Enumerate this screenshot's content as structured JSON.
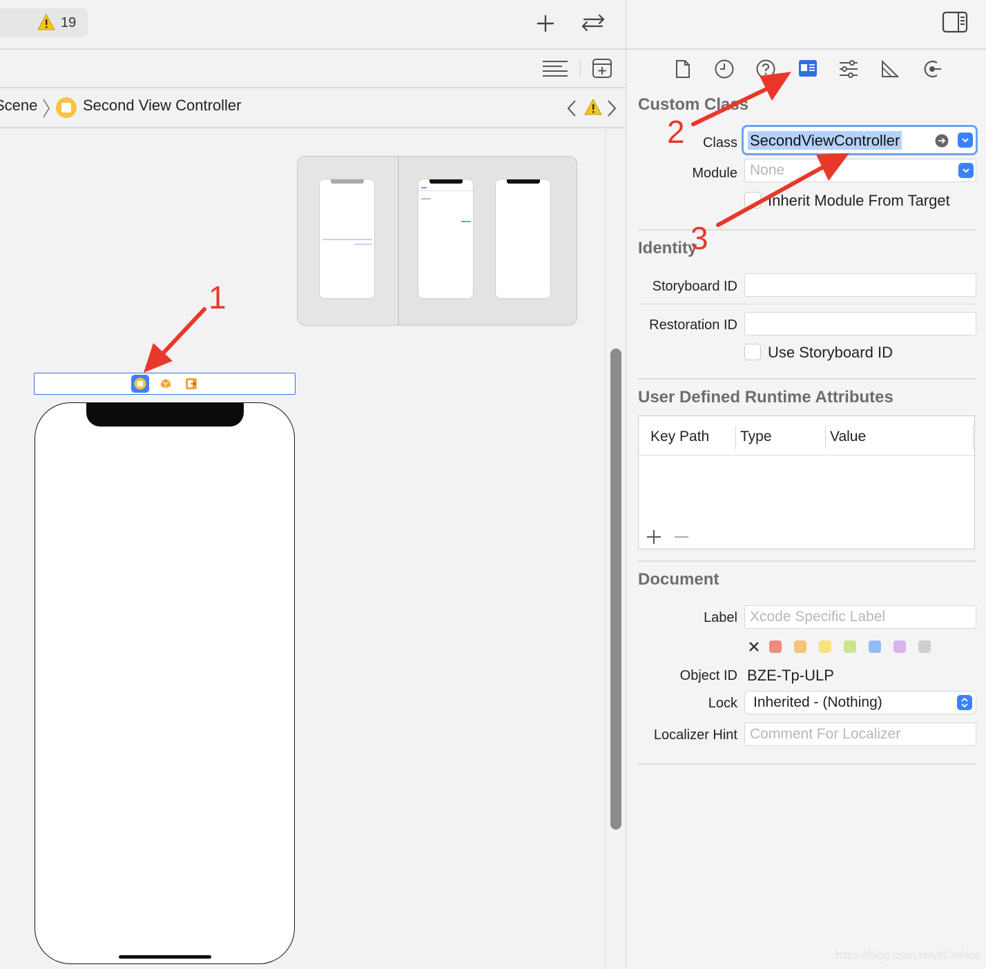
{
  "toolbar": {
    "warning_count": "19"
  },
  "breadcrumb": {
    "scene": "Scene",
    "controller": "Second View Controller"
  },
  "inspector": {
    "custom_class": {
      "title": "Custom Class",
      "class_label": "Class",
      "class_value": "SecondViewController",
      "module_label": "Module",
      "module_placeholder": "None",
      "inherit_label": "Inherit Module From Target"
    },
    "identity": {
      "title": "Identity",
      "storyboard_id_label": "Storyboard ID",
      "restoration_id_label": "Restoration ID",
      "use_storyboard_id_label": "Use Storyboard ID"
    },
    "runtime_attributes": {
      "title": "User Defined Runtime Attributes",
      "columns": [
        "Key Path",
        "Type",
        "Value"
      ]
    },
    "document": {
      "title": "Document",
      "label_label": "Label",
      "label_placeholder": "Xcode Specific Label",
      "object_id_label": "Object ID",
      "object_id_value": "BZE-Tp-ULP",
      "lock_label": "Lock",
      "lock_value": "Inherited - (Nothing)",
      "localizer_label": "Localizer Hint",
      "localizer_placeholder": "Comment For Localizer",
      "label_colors": [
        "#f08a80",
        "#f5c47a",
        "#f8e27f",
        "#c9e68a",
        "#8fbdf3",
        "#d6b4ec",
        "#cfcfcf"
      ]
    }
  },
  "annotations": {
    "step1": "1",
    "step2": "2",
    "step3": "3",
    "arrow_color": "#e8382a"
  },
  "watermark": "https://blog.csdn.net/itCatface"
}
